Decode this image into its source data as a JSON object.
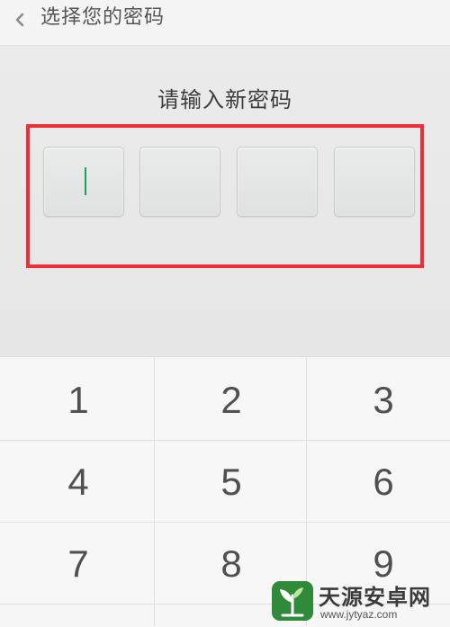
{
  "header": {
    "back_icon": "chevron-left-icon",
    "title": "选择您的密码"
  },
  "prompt": "请输入新密码",
  "pin": {
    "length": 4,
    "entered": 0
  },
  "keypad": {
    "keys": [
      "1",
      "2",
      "3",
      "4",
      "5",
      "6",
      "7",
      "8",
      "9"
    ]
  },
  "colors": {
    "highlight": "#ee2f3a",
    "cursor": "#1aa05a"
  },
  "watermark": {
    "title": "天源安卓网",
    "url": "www.jytyaz.com",
    "logo_icon": "plant-logo-icon"
  }
}
